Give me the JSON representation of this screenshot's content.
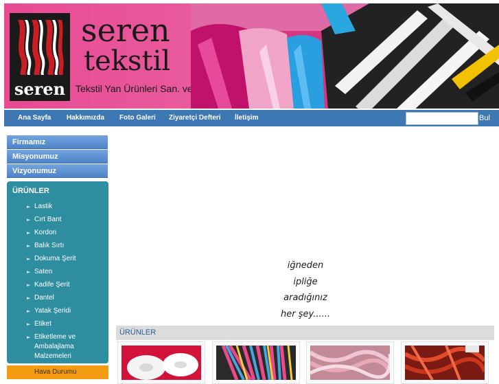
{
  "header": {
    "brand_line1": "seren",
    "brand_line2": "tekstil",
    "logo_word": "seren",
    "subtitle": "Tekstil Yan Ürünleri San. ve Tic."
  },
  "nav": {
    "items": [
      "Ana Sayfa",
      "Hakkımızda",
      "Foto Galeri",
      "Ziyaretçi Defteri",
      "İletişim"
    ],
    "search_value": "",
    "search_button": "Bul"
  },
  "sidebar": {
    "links": [
      "Firmamız",
      "Misyonumuz",
      "Vizyonumuz"
    ],
    "products_title": "ÜRÜNLER",
    "products": [
      "Lastik",
      "Cırt Bant",
      "Kordon",
      "Balık Sırtı",
      "Dokuma Şerit",
      "Saten",
      "Kadife Şerit",
      "Dantel",
      "Yatak Şeridi",
      "Etiket",
      "Etiketleme ve Ambalajlama Malzemeleri"
    ],
    "weather": "Hava Durumu"
  },
  "main": {
    "slogan": [
      "iğneden",
      "ipliğe",
      "aradığınız",
      "her şey......"
    ],
    "products_header": "ÜRÜNLER"
  },
  "colors": {
    "nav_bg": "#3e78b3",
    "sidebar_button": "#5b8fd0",
    "products_panel": "#2f8da0",
    "weather": "#f39c12",
    "banner_pink": "#e84a94"
  }
}
